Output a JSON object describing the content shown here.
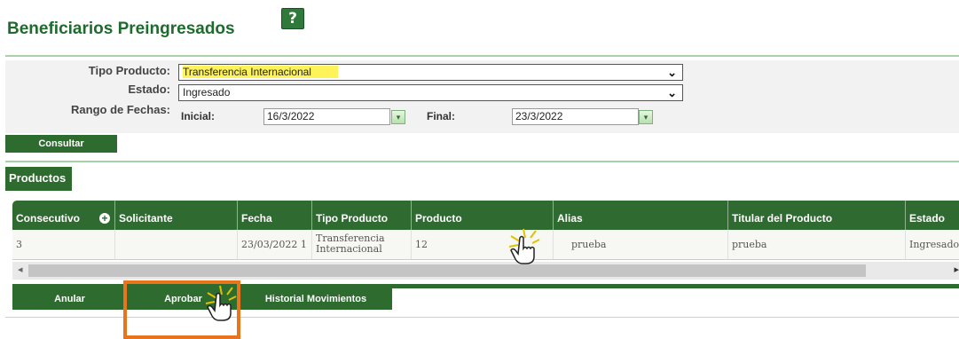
{
  "header": {
    "title": "Beneficiarios Preingresados",
    "help_icon": "?"
  },
  "filters": {
    "tipo_producto_label": "Tipo Producto:",
    "tipo_producto_value": "Transferencia Internacional",
    "estado_label": "Estado:",
    "estado_value": "Ingresado",
    "rango_label": "Rango de Fechas:",
    "inicial_label": "Inicial:",
    "inicial_value": "16/3/2022",
    "final_label": "Final:",
    "final_value": "23/3/2022",
    "consultar_label": "Consultar"
  },
  "section": {
    "tab_label": "Productos"
  },
  "grid": {
    "columns": [
      "Consecutivo",
      "Solicitante",
      "Fecha",
      "Tipo Producto",
      "Producto",
      "Alias",
      "Titular del Producto",
      "Estado"
    ],
    "rows": [
      {
        "consecutivo": "3",
        "solicitante": "",
        "fecha": "23/03/2022 1",
        "tipo_producto": "Transferencia Internacional",
        "producto": "12",
        "alias": "prueba",
        "titular": "prueba",
        "estado": "Ingresado"
      }
    ]
  },
  "actions": {
    "anular": "Anular",
    "aprobar": "Aprobar",
    "historial": "Historial Movimientos"
  },
  "colors": {
    "brand_green": "#2e6b2f",
    "title_green": "#1f6b2e",
    "highlight": "#fff35a",
    "focus": "#e8741e"
  },
  "icons": {
    "help": "help-icon",
    "calendar": "calendar-icon",
    "add": "add-icon",
    "cursor": "hand-cursor-icon"
  }
}
